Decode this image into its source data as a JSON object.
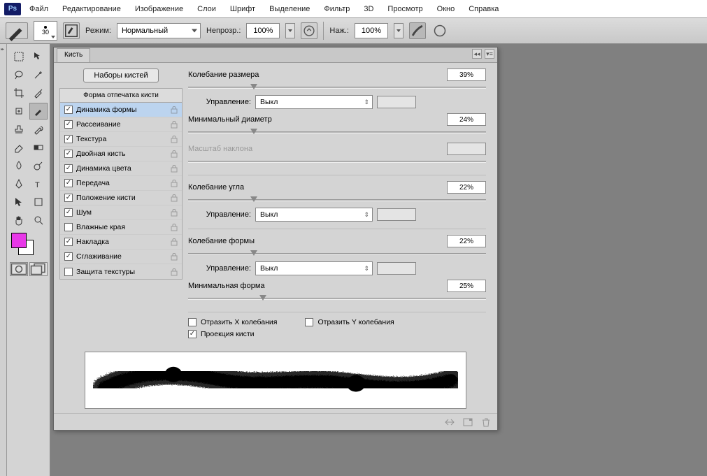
{
  "app": {
    "logo": "Ps"
  },
  "menu": [
    "Файл",
    "Редактирование",
    "Изображение",
    "Слои",
    "Шрифт",
    "Выделение",
    "Фильтр",
    "3D",
    "Просмотр",
    "Окно",
    "Справка"
  ],
  "options": {
    "brush_size": "30",
    "mode_label": "Режим:",
    "mode_value": "Нормальный",
    "opacity_label": "Непрозр.:",
    "opacity_value": "100%",
    "flow_label": "Наж.:",
    "flow_value": "100%"
  },
  "swatch": {
    "fg": "#e838e8",
    "bg": "#ffffff"
  },
  "panel": {
    "title": "Кисть",
    "presets_btn": "Наборы кистей",
    "shape_header": "Форма отпечатка кисти",
    "options": [
      {
        "label": "Динамика формы",
        "checked": true,
        "locked": true,
        "selected": true
      },
      {
        "label": "Рассеивание",
        "checked": true,
        "locked": true
      },
      {
        "label": "Текстура",
        "checked": true,
        "locked": true
      },
      {
        "label": "Двойная кисть",
        "checked": true,
        "locked": true
      },
      {
        "label": "Динамика цвета",
        "checked": true,
        "locked": true
      },
      {
        "label": "Передача",
        "checked": true,
        "locked": true
      },
      {
        "label": "Положение кисти",
        "checked": true,
        "locked": true
      },
      {
        "label": "Шум",
        "checked": true,
        "locked": true
      },
      {
        "label": "Влажные края",
        "checked": false,
        "locked": true
      },
      {
        "label": "Накладка",
        "checked": true,
        "locked": true
      },
      {
        "label": "Сглаживание",
        "checked": true,
        "locked": true
      },
      {
        "label": "Защита текстуры",
        "checked": false,
        "locked": true
      }
    ],
    "controls": {
      "size_jitter": {
        "label": "Колебание размера",
        "value": "39%",
        "pos": 22
      },
      "ctrl1": {
        "label": "Управление:",
        "value": "Выкл"
      },
      "min_diam": {
        "label": "Минимальный диаметр",
        "value": "24%",
        "pos": 22
      },
      "tilt": {
        "label": "Масштаб наклона"
      },
      "angle_jitter": {
        "label": "Колебание угла",
        "value": "22%",
        "pos": 22
      },
      "ctrl2": {
        "label": "Управление:",
        "value": "Выкл"
      },
      "round_jitter": {
        "label": "Колебание формы",
        "value": "22%",
        "pos": 22
      },
      "ctrl3": {
        "label": "Управление:",
        "value": "Выкл"
      },
      "min_round": {
        "label": "Минимальная форма",
        "value": "25%",
        "pos": 25
      },
      "flip_x": {
        "label": "Отразить X колебания",
        "checked": false
      },
      "flip_y": {
        "label": "Отразить Y колебания",
        "checked": false
      },
      "projection": {
        "label": "Проекция кисти",
        "checked": true
      }
    }
  }
}
